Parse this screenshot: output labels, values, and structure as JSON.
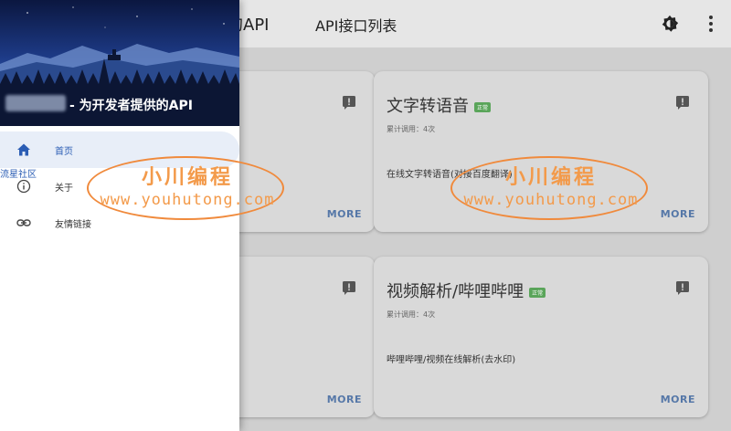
{
  "app_bar": {
    "title_fragment": "供的API",
    "nav_link": "API接口列表",
    "theme_icon": "theme-toggle-icon",
    "menu_icon": "more-vert-icon"
  },
  "cards": [
    {
      "title": "文字转语音",
      "badge": "正常",
      "meta": "累计调用：4次",
      "description": "在线文字转语音(对接百度翻译)",
      "more_label": "MORE"
    },
    {
      "title": "视频解析/哔哩哔哩",
      "badge": "正常",
      "meta": "累计调用：4次",
      "description": "哔哩哔哩/视频在线解析(去水印)",
      "more_label": "MORE"
    },
    {
      "more_label": "MORE"
    },
    {
      "more_label": "MORE"
    }
  ],
  "drawer": {
    "site_name": "- 为开发者提供的API",
    "side_tag": "流星社区",
    "items": [
      {
        "label": "首页",
        "icon": "home-icon",
        "active": true
      },
      {
        "label": "关于",
        "icon": "info-icon",
        "active": false
      },
      {
        "label": "友情链接",
        "icon": "link-icon",
        "active": false
      }
    ]
  },
  "watermark": {
    "line1": "小川编程",
    "line2": "www.youhutong.com"
  },
  "colors": {
    "accent": "#2b5db4",
    "more_link": "#5678a8",
    "badge": "#5aa55a",
    "watermark": "#f39a4a"
  }
}
